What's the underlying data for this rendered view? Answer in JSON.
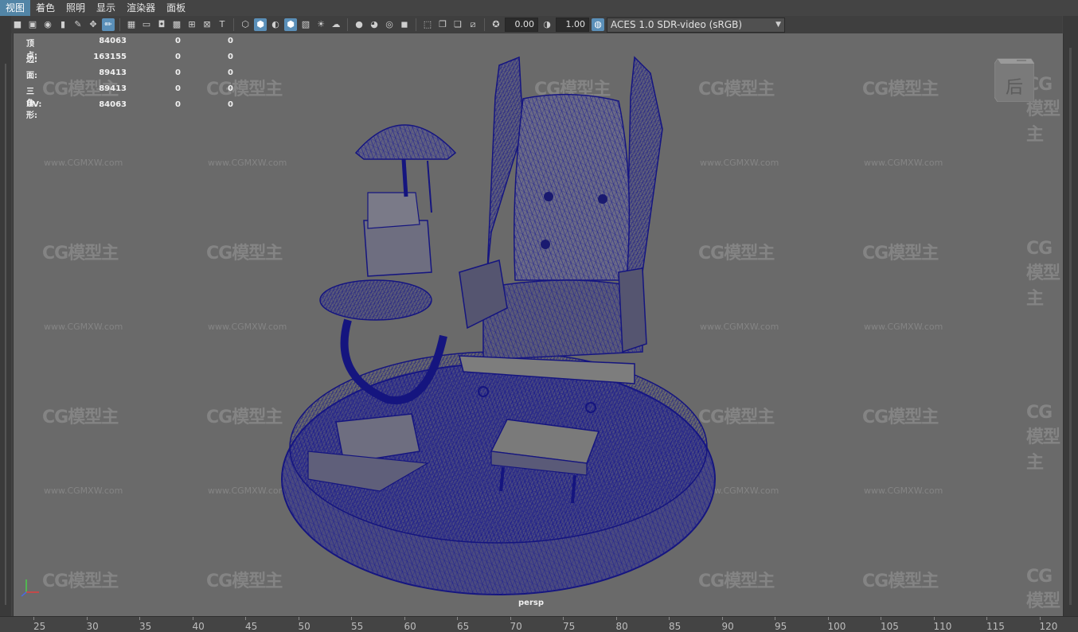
{
  "menu": [
    "视图",
    "着色",
    "照明",
    "显示",
    "渲染器",
    "面板"
  ],
  "toolbar": {
    "value_a": "0.00",
    "value_b": "1.00",
    "colorspace": "ACES 1.0 SDR-video (sRGB)"
  },
  "hud": {
    "rows": [
      {
        "label": "顶点:",
        "v1": "84063",
        "v2": "0",
        "v3": "0"
      },
      {
        "label": "边:",
        "v1": "163155",
        "v2": "0",
        "v3": "0"
      },
      {
        "label": "面:",
        "v1": "89413",
        "v2": "0",
        "v3": "0"
      },
      {
        "label": "三角形:",
        "v1": "89413",
        "v2": "0",
        "v3": "0"
      },
      {
        "label": "UV:",
        "v1": "84063",
        "v2": "0",
        "v3": "0"
      }
    ]
  },
  "viewport": {
    "camera": "persp",
    "viewcube_label": "后"
  },
  "watermark": {
    "logo": "CG模型主",
    "url": "www.CGMXW.com"
  },
  "timeline": {
    "ticks": [
      "25",
      "30",
      "35",
      "40",
      "45",
      "50",
      "55",
      "60",
      "65",
      "70",
      "75",
      "80",
      "85",
      "90",
      "95",
      "100",
      "105",
      "110",
      "115",
      "120"
    ]
  },
  "colors": {
    "wireframe": "#1a1a8a",
    "viewport_bg": "#6a6a6a",
    "menu_active": "#5285a6"
  }
}
